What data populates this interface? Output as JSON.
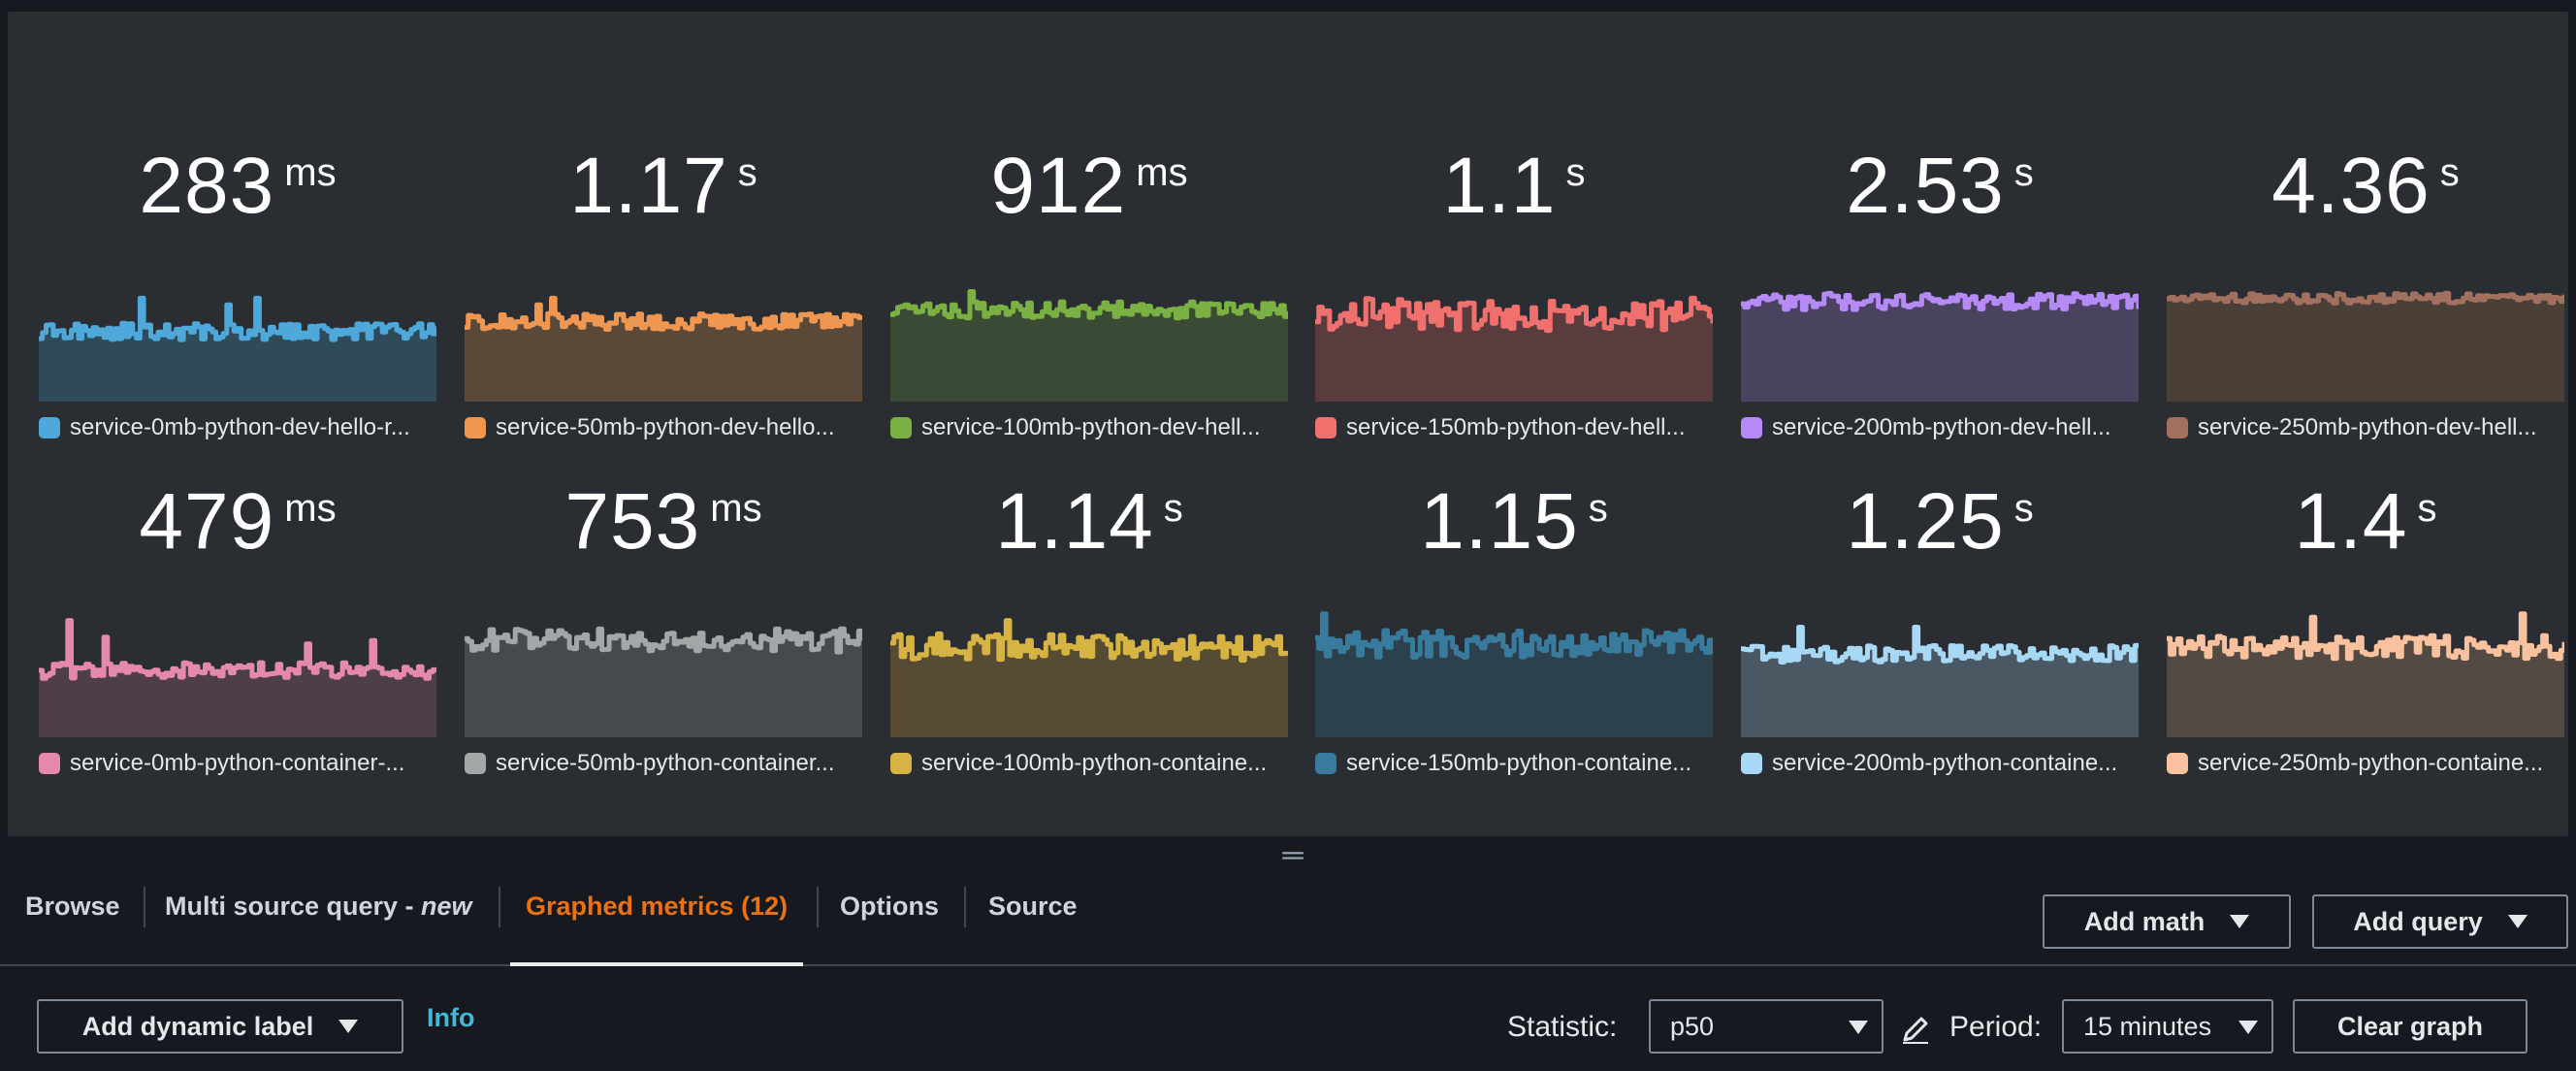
{
  "tiles": [
    {
      "value": "283",
      "unit": "ms",
      "label": "service-0mb-python-dev-hello-r...",
      "color": "#4ea8d9",
      "fill": "#2f4b59",
      "level": 0.42,
      "amp": 0.05,
      "spikes": [
        [
          28,
          0.62
        ],
        [
          52,
          0.58
        ],
        [
          60,
          0.62
        ]
      ]
    },
    {
      "value": "1.17",
      "unit": "s",
      "label": "service-50mb-python-dev-hello...",
      "color": "#ef9650",
      "fill": "#5a4838",
      "level": 0.48,
      "amp": 0.05,
      "spikes": [
        [
          20,
          0.58
        ],
        [
          24,
          0.62
        ]
      ]
    },
    {
      "value": "912",
      "unit": "ms",
      "label": "service-100mb-python-dev-hell...",
      "color": "#7bb043",
      "fill": "#3b4a35",
      "level": 0.55,
      "amp": 0.05,
      "spikes": [
        [
          22,
          0.66
        ]
      ]
    },
    {
      "value": "1.1",
      "unit": "s",
      "label": "service-150mb-python-dev-hell...",
      "color": "#f0706d",
      "fill": "#5a3c3e",
      "level": 0.52,
      "amp": 0.1,
      "spikes": []
    },
    {
      "value": "2.53",
      "unit": "s",
      "label": "service-200mb-python-dev-hell...",
      "color": "#b58af6",
      "fill": "#4a4360",
      "level": 0.6,
      "amp": 0.05,
      "spikes": []
    },
    {
      "value": "4.36",
      "unit": "s",
      "label": "service-250mb-python-dev-hell...",
      "color": "#a1705e",
      "fill": "#4b4038",
      "level": 0.62,
      "amp": 0.03,
      "spikes": []
    },
    {
      "value": "479",
      "unit": "ms",
      "label": "service-0mb-python-container-...",
      "color": "#e589ac",
      "fill": "#4e3e47",
      "level": 0.4,
      "amp": 0.05,
      "spikes": [
        [
          8,
          0.7
        ],
        [
          18,
          0.6
        ],
        [
          74,
          0.56
        ],
        [
          92,
          0.58
        ]
      ]
    },
    {
      "value": "753",
      "unit": "ms",
      "label": "service-50mb-python-container...",
      "color": "#a2a7a8",
      "fill": "#46494d",
      "level": 0.58,
      "amp": 0.07,
      "spikes": []
    },
    {
      "value": "1.14",
      "unit": "s",
      "label": "service-100mb-python-containe...",
      "color": "#d6b343",
      "fill": "#564c33",
      "level": 0.54,
      "amp": 0.08,
      "spikes": [
        [
          32,
          0.7
        ]
      ]
    },
    {
      "value": "1.15",
      "unit": "s",
      "label": "service-150mb-python-containe...",
      "color": "#397b9c",
      "fill": "#2c414d",
      "level": 0.56,
      "amp": 0.08,
      "spikes": [
        [
          2,
          0.74
        ]
      ]
    },
    {
      "value": "1.25",
      "unit": "s",
      "label": "service-200mb-python-containe...",
      "color": "#a7d8f5",
      "fill": "#4a5864",
      "level": 0.5,
      "amp": 0.05,
      "spikes": [
        [
          16,
          0.66
        ],
        [
          48,
          0.66
        ]
      ]
    },
    {
      "value": "1.4",
      "unit": "s",
      "label": "service-250mb-python-containe...",
      "color": "#f9c19d",
      "fill": "#534a44",
      "level": 0.54,
      "amp": 0.07,
      "spikes": [
        [
          40,
          0.72
        ],
        [
          98,
          0.74
        ]
      ]
    }
  ],
  "tabs": {
    "browse": "Browse",
    "multi_source_main": "Multi source query - ",
    "multi_source_new": "new",
    "graphed": "Graphed metrics (12)",
    "options": "Options",
    "source": "Source"
  },
  "actions": {
    "add_math": "Add math",
    "add_query": "Add query",
    "add_dynamic_label": "Add dynamic label",
    "info": "Info",
    "clear_graph": "Clear graph"
  },
  "controls": {
    "statistic_label": "Statistic:",
    "statistic_value": "p50",
    "period_label": "Period:",
    "period_value": "15 minutes"
  },
  "colors": {
    "accent_tab": "#ec7211",
    "info_link": "#44b9d6",
    "panel_bg": "#2a2e33",
    "page_bg": "#16191f"
  }
}
